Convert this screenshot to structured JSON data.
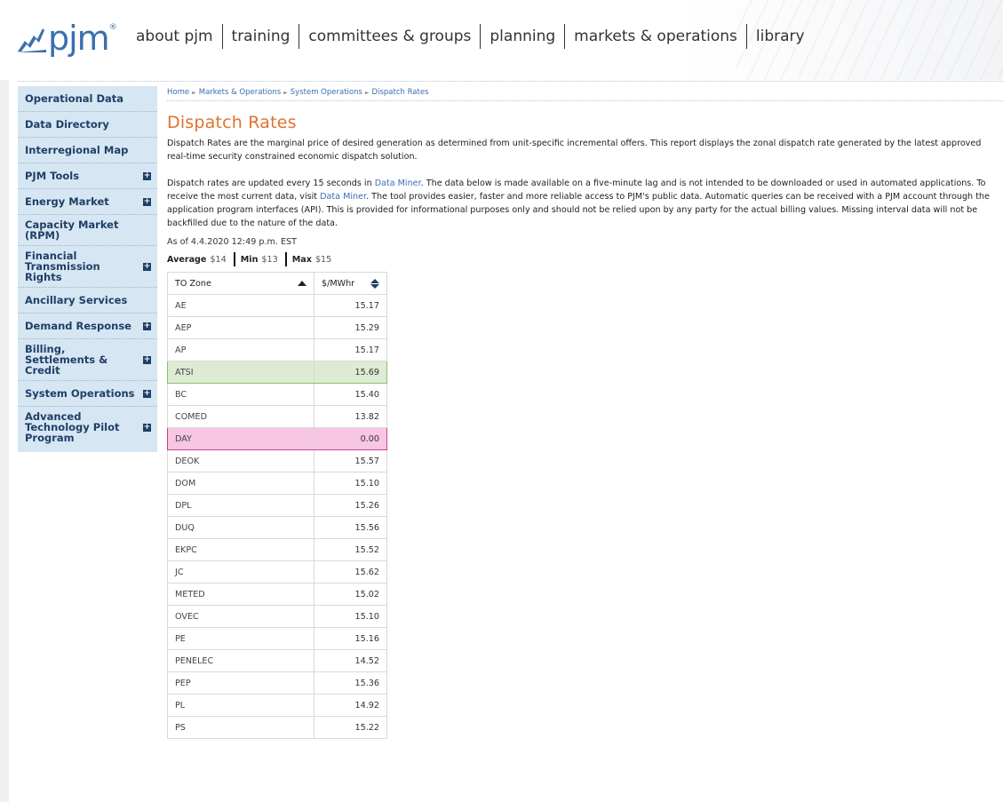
{
  "header": {
    "logo_text": "pjm",
    "logo_tm": "®",
    "nav": [
      "about pjm",
      "training",
      "committees & groups",
      "planning",
      "markets & operations",
      "library"
    ]
  },
  "sidebar": {
    "items": [
      {
        "label": "Operational Data",
        "expandable": false
      },
      {
        "label": "Data Directory",
        "expandable": false
      },
      {
        "label": "Interregional Map",
        "expandable": false
      },
      {
        "label": "PJM Tools",
        "expandable": true
      },
      {
        "label": "Energy Market",
        "expandable": true
      },
      {
        "label": "Capacity Market (RPM)",
        "expandable": false
      },
      {
        "label": "Financial Transmission Rights",
        "expandable": true
      },
      {
        "label": "Ancillary Services",
        "expandable": false
      },
      {
        "label": "Demand Response",
        "expandable": true
      },
      {
        "label": "Billing, Settlements & Credit",
        "expandable": true
      },
      {
        "label": "System Operations",
        "expandable": true
      },
      {
        "label": "Advanced Technology Pilot Program",
        "expandable": true
      }
    ]
  },
  "breadcrumb": {
    "home": "Home",
    "level1": "Markets & Operations",
    "level2": "System Operations",
    "current": "Dispatch Rates",
    "sep": "►"
  },
  "page": {
    "title": "Dispatch Rates",
    "para1": "Dispatch Rates are the marginal price of desired generation as determined from unit-specific incremental offers. This report displays the zonal dispatch rate generated by the latest approved real-time security constrained economic dispatch solution.",
    "para2_a": "Dispatch rates are updated every 15 seconds in ",
    "para2_link1": "Data Miner",
    "para2_b": ". The data below is made available on a five-minute lag and is not intended to be downloaded or used in automated applications. To receive the most current data, visit ",
    "para2_link2": "Data Miner",
    "para2_c": ". The tool provides easier, faster and more reliable access to PJM's public data. Automatic queries can be received with a PJM account through the application program interfaces (API). This is provided for informational purposes only and should not be relied upon by any party for the actual billing values. Missing interval data will not be backfilled due to the nature of the data.",
    "as_of": "As of 4.4.2020 12:49 p.m. EST"
  },
  "stats": {
    "average_label": "Average",
    "average_value": "$14",
    "min_label": "Min",
    "min_value": "$13",
    "max_label": "Max",
    "max_value": "$15"
  },
  "table": {
    "col_zone": "TO Zone",
    "col_rate": "$/MWhr",
    "rows": [
      {
        "zone": "AE",
        "rate": "15.17",
        "hl": ""
      },
      {
        "zone": "AEP",
        "rate": "15.29",
        "hl": ""
      },
      {
        "zone": "AP",
        "rate": "15.17",
        "hl": ""
      },
      {
        "zone": "ATSI",
        "rate": "15.69",
        "hl": "green"
      },
      {
        "zone": "BC",
        "rate": "15.40",
        "hl": ""
      },
      {
        "zone": "COMED",
        "rate": "13.82",
        "hl": ""
      },
      {
        "zone": "DAY",
        "rate": "0.00",
        "hl": "pink"
      },
      {
        "zone": "DEOK",
        "rate": "15.57",
        "hl": ""
      },
      {
        "zone": "DOM",
        "rate": "15.10",
        "hl": ""
      },
      {
        "zone": "DPL",
        "rate": "15.26",
        "hl": ""
      },
      {
        "zone": "DUQ",
        "rate": "15.56",
        "hl": ""
      },
      {
        "zone": "EKPC",
        "rate": "15.52",
        "hl": ""
      },
      {
        "zone": "JC",
        "rate": "15.62",
        "hl": ""
      },
      {
        "zone": "METED",
        "rate": "15.02",
        "hl": ""
      },
      {
        "zone": "OVEC",
        "rate": "15.10",
        "hl": ""
      },
      {
        "zone": "PE",
        "rate": "15.16",
        "hl": ""
      },
      {
        "zone": "PENELEC",
        "rate": "14.52",
        "hl": ""
      },
      {
        "zone": "PEP",
        "rate": "15.36",
        "hl": ""
      },
      {
        "zone": "PL",
        "rate": "14.92",
        "hl": ""
      },
      {
        "zone": "PS",
        "rate": "15.22",
        "hl": ""
      }
    ]
  },
  "colors": {
    "accent_orange": "#e0732e",
    "brand_blue": "#3b6fb0",
    "sidebar_bg": "#d6e6f3",
    "highlight_max": "#dcebd2",
    "highlight_min": "#f6c6e2"
  }
}
